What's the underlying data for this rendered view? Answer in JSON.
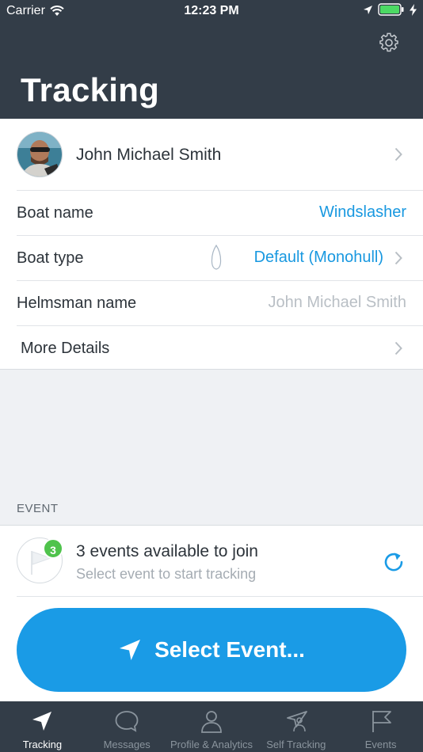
{
  "status": {
    "carrier": "Carrier",
    "time": "12:23 PM"
  },
  "header": {
    "title": "Tracking",
    "settings_icon": "gear-icon"
  },
  "profile": {
    "name": "John Michael Smith"
  },
  "details": {
    "boat_name_label": "Boat name",
    "boat_name_value": "Windslasher",
    "boat_type_label": "Boat type",
    "boat_type_value": "Default (Monohull)",
    "helmsman_label": "Helmsman name",
    "helmsman_placeholder": "John Michael Smith",
    "more_details_label": "More Details"
  },
  "event_section": {
    "label": "EVENT",
    "badge_count": "3",
    "title": "3 events available to join",
    "subtitle": "Select event to start tracking",
    "select_button": "Select Event..."
  },
  "tabs": [
    {
      "label": "Tracking",
      "icon": "navigation-arrow-icon",
      "active": true
    },
    {
      "label": "Messages",
      "icon": "chat-bubble-icon"
    },
    {
      "label": "Profile & Analytics",
      "icon": "person-icon"
    },
    {
      "label": "Self Tracking",
      "icon": "self-tracking-icon"
    },
    {
      "label": "Events",
      "icon": "flag-icon"
    }
  ],
  "colors": {
    "header_bg": "#333d48",
    "accent": "#1a9be6",
    "badge": "#4fc34c",
    "battery": "#4cd964"
  }
}
